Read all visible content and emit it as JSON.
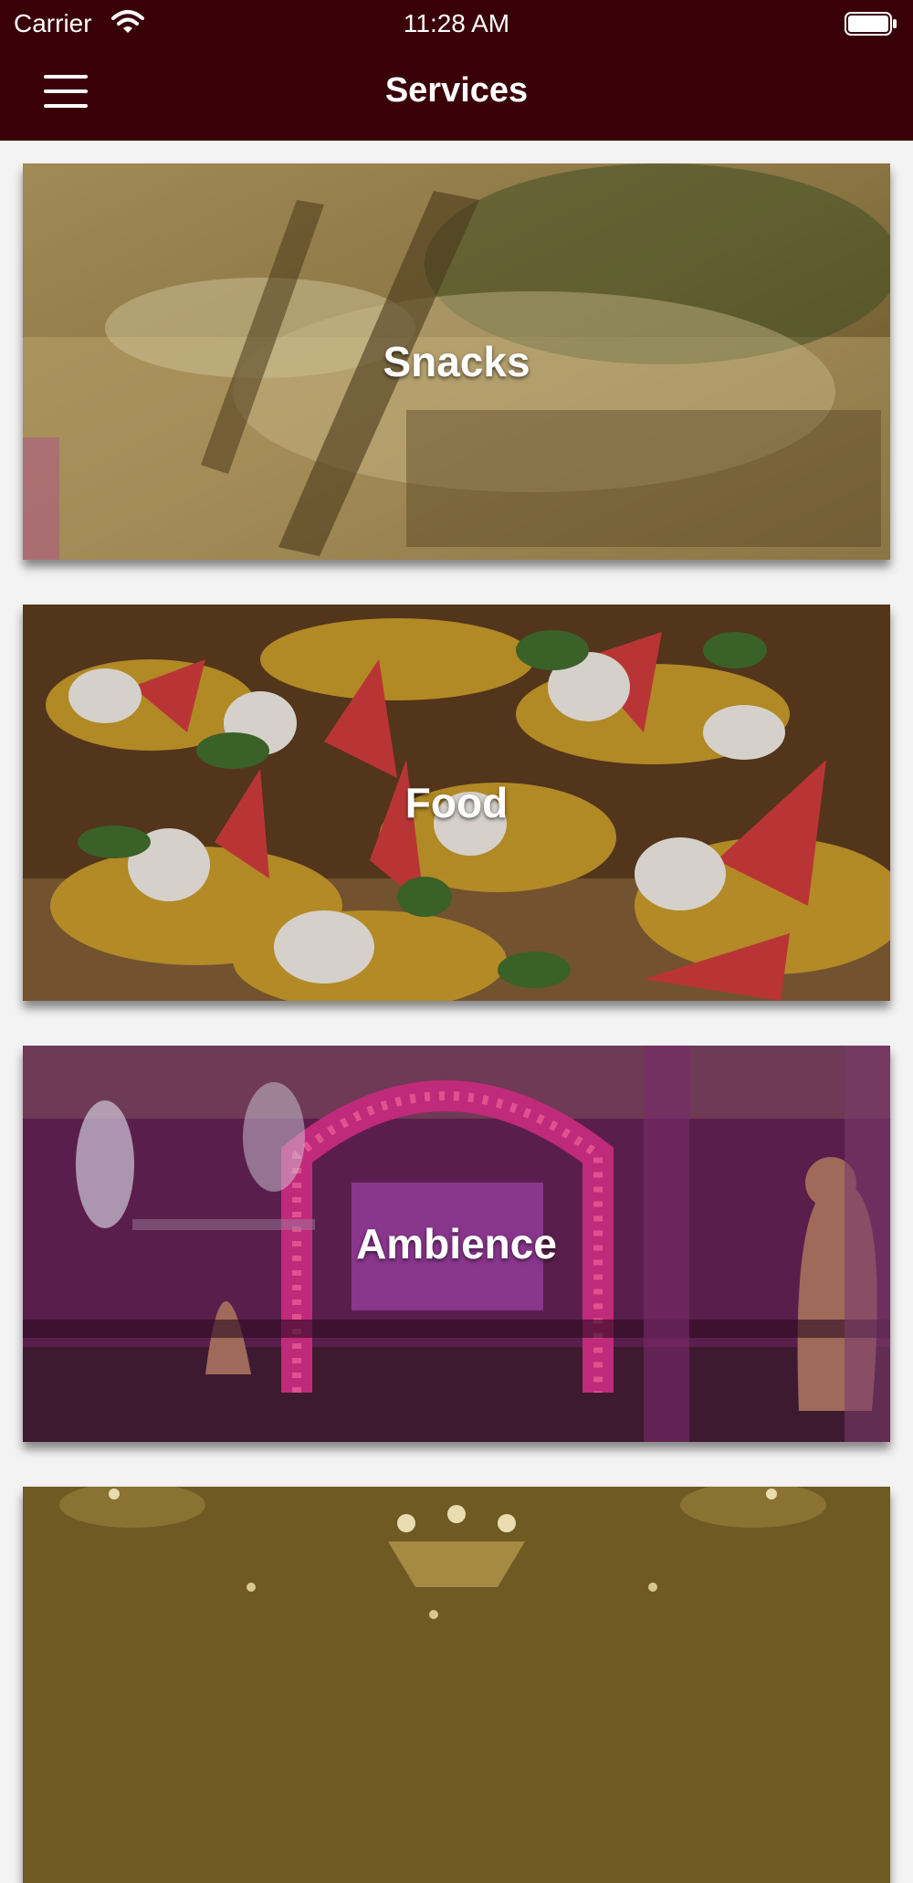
{
  "status_bar": {
    "carrier": "Carrier",
    "time": "11:28 AM"
  },
  "header": {
    "title": "Services",
    "menu_icon": "hamburger-menu-icon"
  },
  "services": [
    {
      "label": "Snacks"
    },
    {
      "label": "Food"
    },
    {
      "label": "Ambience"
    },
    {
      "label": ""
    }
  ],
  "colors": {
    "header_background": "#3a0008",
    "header_text": "#ffffff",
    "page_background": "#f3f3f3"
  }
}
